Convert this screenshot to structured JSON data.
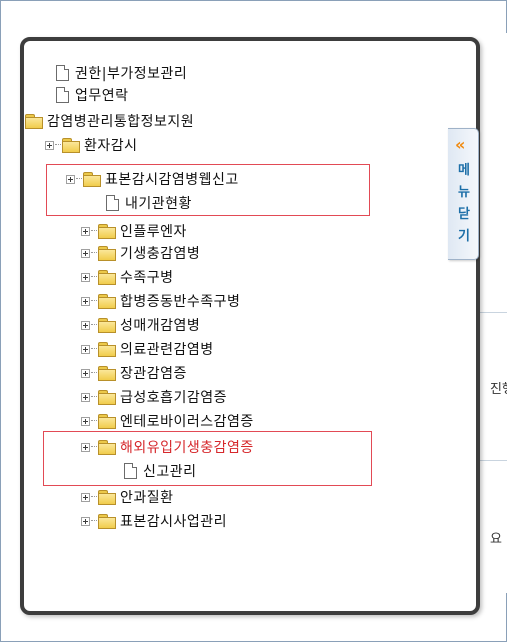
{
  "tree": [
    {
      "label": "권한|부가정보관리",
      "type": "doc"
    },
    {
      "label": "업무연락",
      "type": "doc"
    },
    {
      "label": "감염병관리통합정보지원",
      "type": "folder"
    },
    {
      "label": "환자감시",
      "type": "folder"
    },
    {
      "label": "표본감시감염병웹신고",
      "type": "folder"
    },
    {
      "label": "내기관현황",
      "type": "doc"
    },
    {
      "label": "인플루엔자",
      "type": "folder"
    },
    {
      "label": "기생충감염병",
      "type": "folder"
    },
    {
      "label": "수족구병",
      "type": "folder"
    },
    {
      "label": "합병증동반수족구병",
      "type": "folder"
    },
    {
      "label": "성매개감염병",
      "type": "folder"
    },
    {
      "label": "의료관련감염병",
      "type": "folder"
    },
    {
      "label": "장관감염증",
      "type": "folder"
    },
    {
      "label": "급성호흡기감염증",
      "type": "folder"
    },
    {
      "label": "엔테로바이러스감염증",
      "type": "folder"
    },
    {
      "label": "해외유입기생충감염증",
      "type": "folder",
      "color": "#d6282c"
    },
    {
      "label": "신고관리",
      "type": "doc"
    },
    {
      "label": "안과질환",
      "type": "folder"
    },
    {
      "label": "표본감시사업관리",
      "type": "folder"
    }
  ],
  "menu_tab": {
    "chevron": "«",
    "chars": [
      "메",
      "뉴",
      "닫",
      "기"
    ]
  },
  "background": {
    "snippets": [
      "진행",
      "요"
    ]
  },
  "colors": {
    "highlight_border": "#e24a55",
    "highlight_text": "#d6282c",
    "menu_chevron": "#f08a10",
    "menu_text": "#1d6fa8"
  }
}
